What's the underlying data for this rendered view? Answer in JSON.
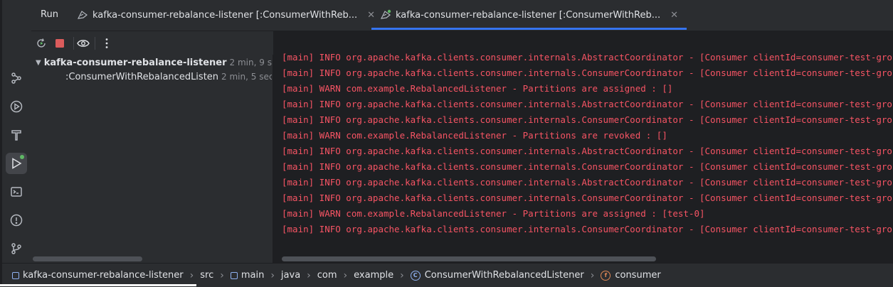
{
  "run": {
    "title": "Run"
  },
  "tabs": [
    {
      "label": "kafka-consumer-rebalance-listener [:ConsumerWithReb...",
      "icon": "run-config-icon",
      "active": false
    },
    {
      "label": "kafka-consumer-rebalance-listener [:ConsumerWithReb...",
      "icon": "run-config-running-icon",
      "active": true
    }
  ],
  "tab_close": "✕",
  "tree": {
    "root": {
      "label": "kafka-consumer-rebalance-listener",
      "time": "2 min, 9 sec"
    },
    "child": {
      "label": ":ConsumerWithRebalancedListen",
      "time": "2 min, 5 sec"
    }
  },
  "console": {
    "lines": [
      "[main] INFO org.apache.kafka.clients.consumer.internals.AbstractCoordinator - [Consumer clientId=consumer-test-group-1, gro",
      "[main] INFO org.apache.kafka.clients.consumer.internals.ConsumerCoordinator - [Consumer clientId=consumer-test-group-1, gro",
      "[main] WARN com.example.RebalancedListener - Partitions are assigned : []",
      "[main] INFO org.apache.kafka.clients.consumer.internals.AbstractCoordinator - [Consumer clientId=consumer-test-group-1, gro",
      "[main] INFO org.apache.kafka.clients.consumer.internals.ConsumerCoordinator - [Consumer clientId=consumer-test-group-1, gro",
      "[main] WARN com.example.RebalancedListener - Partitions are revoked : []",
      "[main] INFO org.apache.kafka.clients.consumer.internals.AbstractCoordinator - [Consumer clientId=consumer-test-group-1, gro",
      "[main] INFO org.apache.kafka.clients.consumer.internals.ConsumerCoordinator - [Consumer clientId=consumer-test-group-1, gro",
      "[main] INFO org.apache.kafka.clients.consumer.internals.AbstractCoordinator - [Consumer clientId=consumer-test-group-1, gro",
      "[main] INFO org.apache.kafka.clients.consumer.internals.ConsumerCoordinator - [Consumer clientId=consumer-test-group-1, gro",
      "[main] WARN com.example.RebalancedListener - Partitions are assigned : [test-0]",
      "[main] INFO org.apache.kafka.clients.consumer.internals.ConsumerCoordinator - [Consumer clientId=consumer-test-group-1, gro"
    ],
    "color": "#f75464"
  },
  "breadcrumb": {
    "module": "kafka-consumer-rebalance-listener",
    "src": "src",
    "main": "main",
    "java": "java",
    "com": "com",
    "example": "example",
    "class": "ConsumerWithRebalancedListener",
    "class_badge": "C",
    "field": "consumer",
    "field_badge": "f"
  },
  "colors": {
    "accent": "#3574f0",
    "running": "#5fb865",
    "stop": "#db5c5c"
  }
}
